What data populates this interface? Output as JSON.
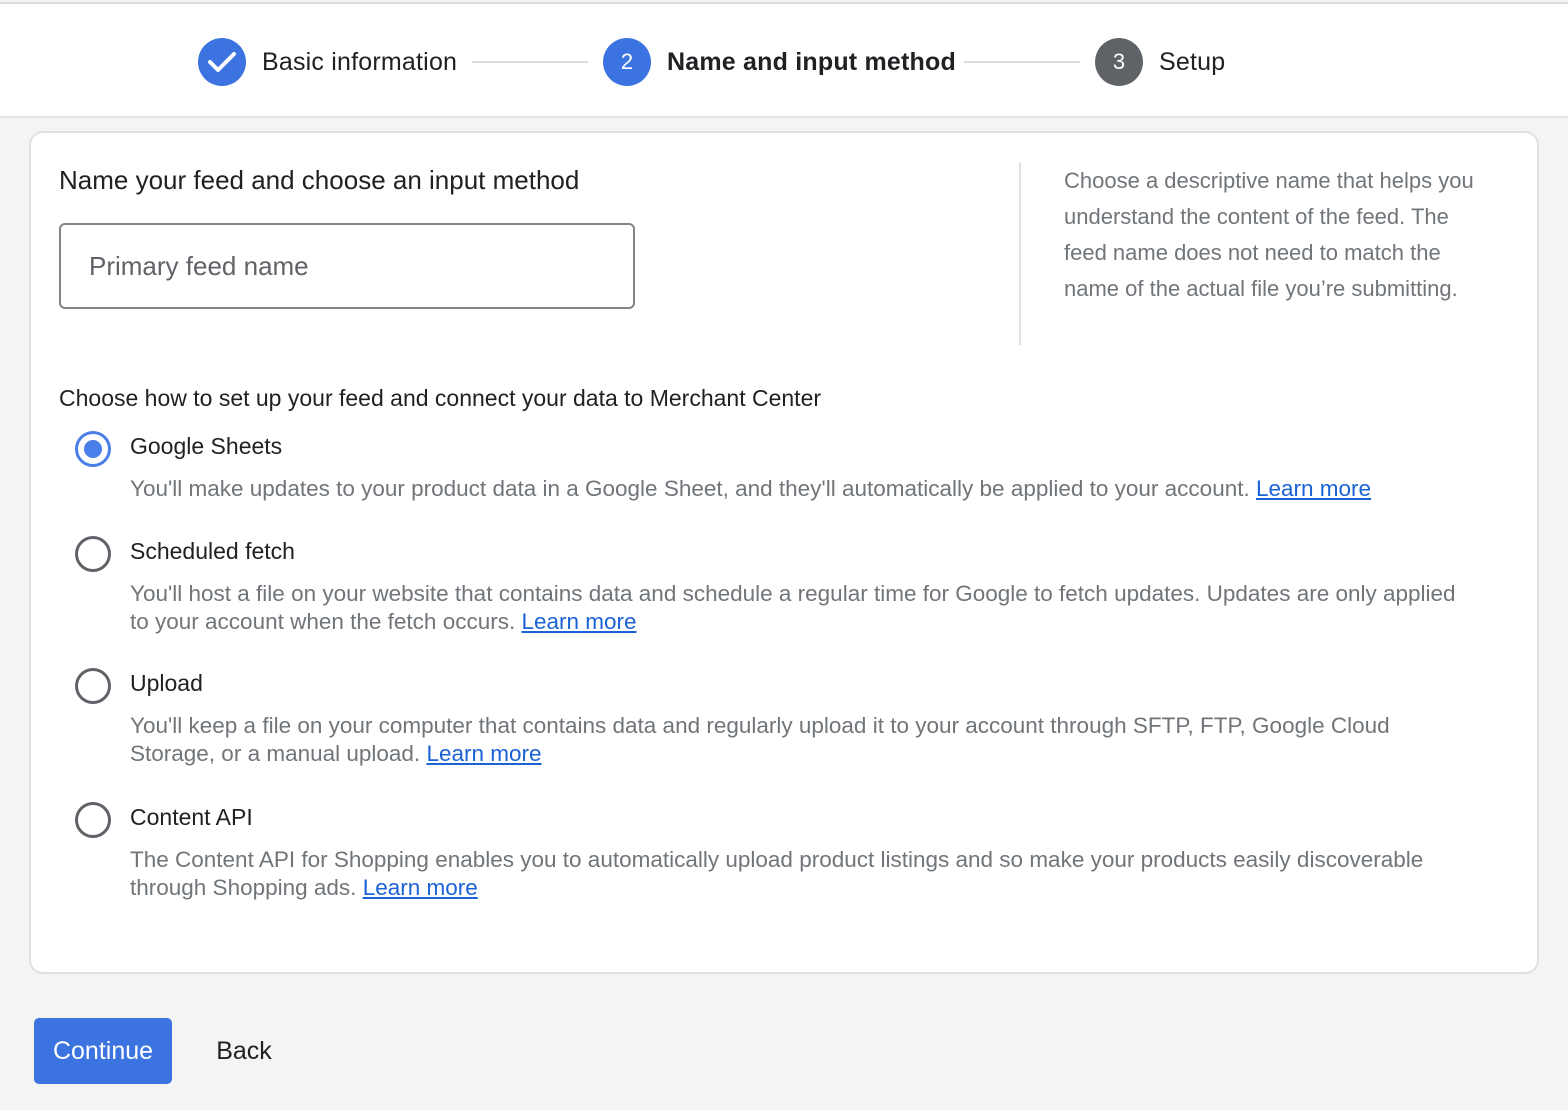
{
  "stepper": {
    "steps": [
      {
        "number": "1",
        "label": "Basic information",
        "state": "completed",
        "icon": "check-icon"
      },
      {
        "number": "2",
        "label": "Name and input method",
        "state": "active"
      },
      {
        "number": "3",
        "label": "Setup",
        "state": "upcoming"
      }
    ],
    "colors": {
      "active": "#3b73e0",
      "upcoming": "#5f6368"
    }
  },
  "card": {
    "title": "Name your feed and choose an input method",
    "feed_name": {
      "value": "",
      "placeholder": "Primary feed name"
    },
    "help_text": "Choose a descriptive name that helps you understand the content of the feed. The feed name does not need to match the name of the actual file you’re submitting.",
    "question": "Choose how to set up your feed and connect your data to Merchant Center",
    "selected_option": "Google Sheets",
    "options": [
      {
        "label": "Google Sheets",
        "checked": true,
        "description": "You'll make updates to your product data in a Google Sheet, and they'll automatically be applied to your account.",
        "link": "Learn more"
      },
      {
        "label": "Scheduled fetch",
        "checked": false,
        "description": "You'll host a file on your website that contains data and schedule a regular time for Google to fetch updates. Updates are only applied to your account when the fetch occurs.",
        "link": "Learn more"
      },
      {
        "label": "Upload",
        "checked": false,
        "description": "You'll keep a file on your computer that contains data and regularly upload it to your account through SFTP, FTP, Google Cloud Storage, or a manual upload.",
        "link": "Learn more"
      },
      {
        "label": "Content API",
        "checked": false,
        "description": "The Content API for Shopping enables you to automatically upload product listings and so make your products easily discoverable through Shopping ads.",
        "link": "Learn more"
      }
    ]
  },
  "footer": {
    "continue_label": "Continue",
    "back_label": "Back",
    "accent_color": "#3b73e0"
  }
}
